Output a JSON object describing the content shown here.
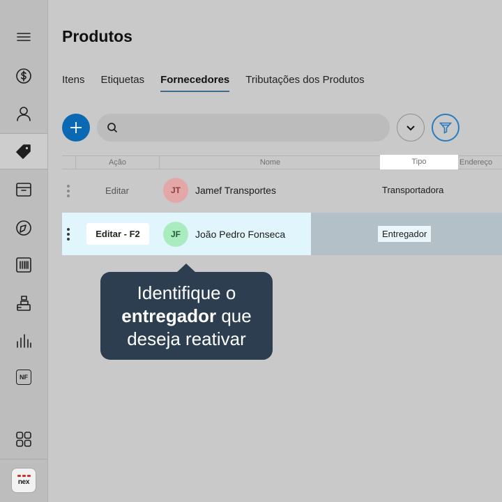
{
  "sidebar": {
    "items": [
      {
        "icon": "menu-icon"
      },
      {
        "icon": "dollar-icon"
      },
      {
        "icon": "user-icon"
      },
      {
        "icon": "tag-icon",
        "active": true
      },
      {
        "icon": "box-icon"
      },
      {
        "icon": "tachometer-icon"
      },
      {
        "icon": "barcode-icon"
      },
      {
        "icon": "register-icon"
      },
      {
        "icon": "bar-chart-icon"
      },
      {
        "icon": "invoice-nf-icon",
        "label": "NF"
      },
      {
        "icon": "apps-grid-icon"
      }
    ],
    "logo_text": "nex"
  },
  "page": {
    "title": "Produtos"
  },
  "tabs": [
    {
      "label": "Itens"
    },
    {
      "label": "Etiquetas"
    },
    {
      "label": "Fornecedores",
      "active": true
    },
    {
      "label": "Tributações dos Produtos"
    }
  ],
  "search": {
    "placeholder": ""
  },
  "table": {
    "headers": {
      "acao": "Ação",
      "nome": "Nome",
      "tipo": "Tipo",
      "endereco": "Endereço"
    },
    "rows": [
      {
        "action": "Editar",
        "initials": "JT",
        "name": "Jamef Transportes",
        "tipo": "Transportadora",
        "avatar_color": "#e4a7a7"
      },
      {
        "action": "Editar - F2",
        "initials": "JF",
        "name": "João Pedro Fonseca",
        "tipo": "Entregador",
        "avatar_color": "#a9ecc0"
      }
    ]
  },
  "tooltip": {
    "line1": "Identifique o",
    "bold": "entregador",
    "line2_rest": " que",
    "line3": "deseja reativar"
  },
  "colors": {
    "primary": "#0b69b3",
    "filter": "#2a7bbd",
    "tooltip_bg": "#2c3e50",
    "highlight": "#e1f5fd"
  }
}
